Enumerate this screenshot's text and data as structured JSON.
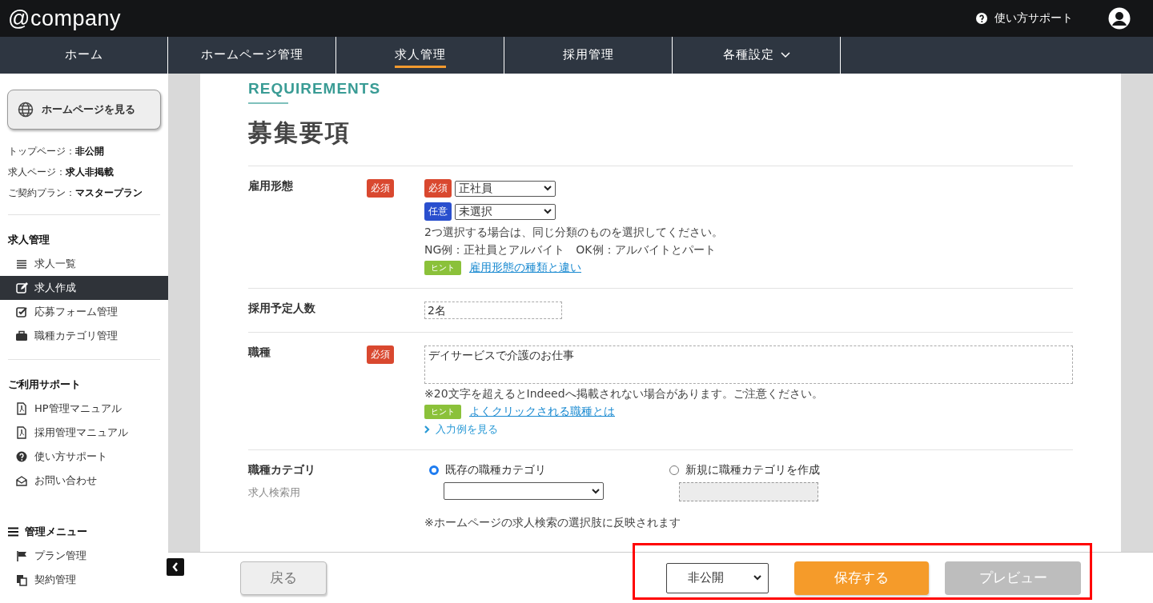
{
  "header": {
    "logo": "@company",
    "help_link": "使い方サポート"
  },
  "nav_tabs": [
    {
      "label": "ホーム",
      "selected": false,
      "dropdown": false
    },
    {
      "label": "ホームページ管理",
      "selected": false,
      "dropdown": false
    },
    {
      "label": "求人管理",
      "selected": true,
      "dropdown": false
    },
    {
      "label": "採用管理",
      "selected": false,
      "dropdown": false
    },
    {
      "label": "各種設定",
      "selected": false,
      "dropdown": true
    }
  ],
  "sidebar": {
    "view_site_button": "ホームページを見る",
    "status": [
      {
        "label": "トップページ：",
        "value": "非公開"
      },
      {
        "label": "求人ページ：",
        "value": "求人非掲載"
      },
      {
        "label": "ご契約プラン：",
        "value": "マスタープラン"
      }
    ],
    "sections": [
      {
        "title": "求人管理",
        "items": [
          {
            "label": "求人一覧",
            "selected": false
          },
          {
            "label": "求人作成",
            "selected": true
          },
          {
            "label": "応募フォーム管理",
            "selected": false
          },
          {
            "label": "職種カテゴリ管理",
            "selected": false
          }
        ]
      },
      {
        "title": "ご利用サポート",
        "items": [
          {
            "label": "HP管理マニュアル",
            "selected": false
          },
          {
            "label": "採用管理マニュアル",
            "selected": false
          },
          {
            "label": "使い方サポート",
            "selected": false
          },
          {
            "label": "お問い合わせ",
            "selected": false
          }
        ]
      },
      {
        "title": "管理メニュー",
        "items": [
          {
            "label": "プラン管理",
            "selected": false
          },
          {
            "label": "契約管理",
            "selected": false
          }
        ]
      }
    ]
  },
  "form": {
    "eyebrow": "REQUIREMENTS",
    "title": "募集要項",
    "rows": [
      {
        "kind": "employment",
        "label": "雇用形態",
        "required_badge": "必須",
        "selects": [
          {
            "badge": "必須",
            "kind": "required",
            "value": "正社員"
          },
          {
            "badge": "任意",
            "kind": "optional",
            "value": "未選択"
          }
        ],
        "notes": [
          "2つ選択する場合は、同じ分類のものを選択してください。",
          "NG例：正社員とアルバイト　OK例：アルバイトとパート"
        ],
        "hint": {
          "tag": "ヒント",
          "link": "雇用形態の種類と違い"
        }
      },
      {
        "kind": "text",
        "label": "採用予定人数",
        "value": "2名"
      },
      {
        "kind": "textarea",
        "label": "職種",
        "required_badge": "必須",
        "value": "デイサービスで介護のお仕事",
        "notes": [
          "※20文字を超えるとIndeedへ掲載されない場合があります。ご注意ください。"
        ],
        "hint": {
          "tag": "ヒント",
          "link": "よくクリックされる職種とは"
        },
        "expander": "入力例を見る"
      },
      {
        "kind": "category",
        "label": "職種カテゴリ",
        "sublabel": "求人検索用",
        "options": [
          {
            "label": "既存の職種カテゴリ",
            "selected": true
          },
          {
            "label": "新規に職種カテゴリを作成",
            "selected": false
          }
        ],
        "notes": [
          "※ホームページの求人検索の選択肢に反映されます"
        ]
      }
    ]
  },
  "footer": {
    "back_button": "戻る",
    "visibility": "非公開",
    "save_button": "保存する",
    "preview_button": {
      "label": "プレビュー",
      "disabled": true
    }
  }
}
